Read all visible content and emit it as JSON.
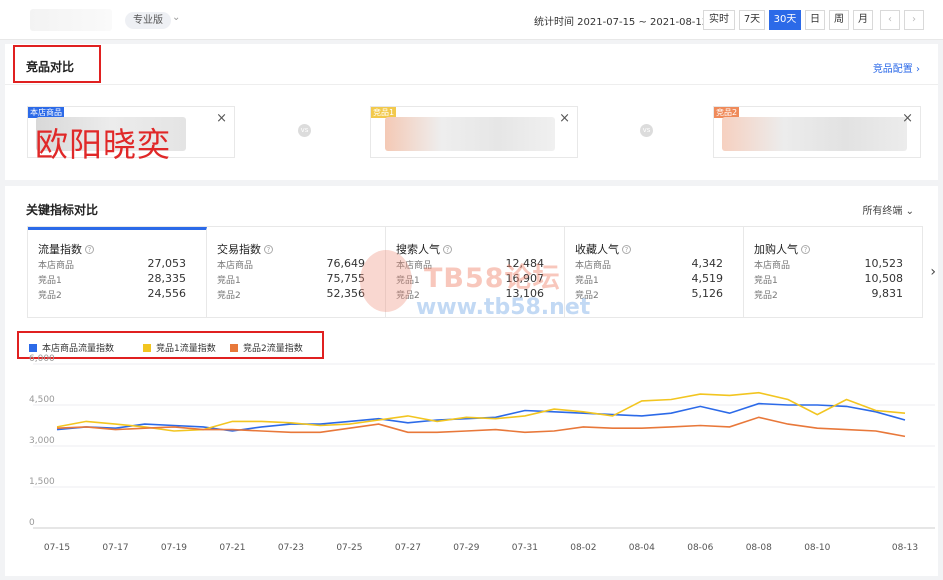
{
  "topbar": {
    "edition": "专业版",
    "period": "统计时间 2021-07-15 ~ 2021-08-13",
    "ranges": [
      "实时",
      "7天",
      "30天",
      "日",
      "周",
      "月"
    ],
    "active_range": "30天",
    "prev": "‹",
    "next": "›"
  },
  "compare": {
    "title": "竞品对比",
    "config_link": "竞品配置 ›",
    "overlay_text": "欧阳晓奕",
    "products": [
      {
        "tag": "本店商品",
        "tag_color": "#2c6ae8"
      },
      {
        "tag": "竞品1",
        "tag_color": "#f2c94c"
      },
      {
        "tag": "竞品2",
        "tag_color": "#ef8a5a"
      }
    ],
    "close": "×",
    "vs": "vs"
  },
  "indicators": {
    "title": "关键指标对比",
    "filter": "所有终端 ⌄",
    "metrics": [
      {
        "name": "流量指数",
        "rows": [
          {
            "label": "本店商品",
            "value": "27,053"
          },
          {
            "label": "竞品1",
            "value": "28,335"
          },
          {
            "label": "竞品2",
            "value": "24,556"
          }
        ]
      },
      {
        "name": "交易指数",
        "rows": [
          {
            "label": "本店商品",
            "value": "76,649"
          },
          {
            "label": "竞品1",
            "value": "75,755"
          },
          {
            "label": "竞品2",
            "value": "52,356"
          }
        ]
      },
      {
        "name": "搜索人气",
        "rows": [
          {
            "label": "本店商品",
            "value": "12,484"
          },
          {
            "label": "竞品1",
            "value": "16,907"
          },
          {
            "label": "竞品2",
            "value": "13,106"
          }
        ]
      },
      {
        "name": "收藏人气",
        "rows": [
          {
            "label": "本店商品",
            "value": "4,342"
          },
          {
            "label": "竞品1",
            "value": "4,519"
          },
          {
            "label": "竞品2",
            "value": "5,126"
          }
        ]
      },
      {
        "name": "加购人气",
        "rows": [
          {
            "label": "本店商品",
            "value": "10,523"
          },
          {
            "label": "竞品1",
            "value": "10,508"
          },
          {
            "label": "竞品2",
            "value": "9,831"
          }
        ]
      }
    ],
    "help": "?",
    "more": "›"
  },
  "watermark": {
    "line1": "TB58论坛",
    "line2": "www.tb58.net"
  },
  "chart_data": {
    "type": "line",
    "x": [
      "07-15",
      "07-16",
      "07-17",
      "07-18",
      "07-19",
      "07-20",
      "07-21",
      "07-22",
      "07-23",
      "07-24",
      "07-25",
      "07-26",
      "07-27",
      "07-28",
      "07-29",
      "07-30",
      "07-31",
      "08-01",
      "08-02",
      "08-03",
      "08-04",
      "08-05",
      "08-06",
      "08-07",
      "08-08",
      "08-09",
      "08-10",
      "08-11",
      "08-12",
      "08-13"
    ],
    "x_tick_labels": [
      "07-15",
      "07-17",
      "07-19",
      "07-21",
      "07-23",
      "07-25",
      "07-27",
      "07-29",
      "07-31",
      "08-02",
      "08-04",
      "08-06",
      "08-08",
      "08-10",
      "08-13"
    ],
    "y_ticks": [
      "6,000",
      "4,500",
      "3,000",
      "1,500",
      "0"
    ],
    "ylim": [
      0,
      6000
    ],
    "series": [
      {
        "name": "本店商品流量指数",
        "color": "#2c6ae8",
        "values": [
          3600,
          3700,
          3650,
          3800,
          3750,
          3700,
          3550,
          3700,
          3800,
          3800,
          3900,
          4000,
          3850,
          3950,
          4000,
          4050,
          4300,
          4250,
          4200,
          4150,
          4100,
          4200,
          4450,
          4200,
          4550,
          4500,
          4500,
          4450,
          4250,
          3950
        ]
      },
      {
        "name": "竞品1流量指数",
        "color": "#f2c520",
        "values": [
          3700,
          3900,
          3800,
          3700,
          3550,
          3600,
          3900,
          3900,
          3850,
          3750,
          3800,
          3950,
          4100,
          3900,
          4050,
          4000,
          4100,
          4350,
          4250,
          4100,
          4650,
          4700,
          4900,
          4850,
          4950,
          4700,
          4150,
          4700,
          4300,
          4200
        ]
      },
      {
        "name": "竞品2流量指数",
        "color": "#e8783a",
        "values": [
          3650,
          3700,
          3600,
          3650,
          3700,
          3600,
          3600,
          3550,
          3500,
          3500,
          3650,
          3800,
          3500,
          3500,
          3550,
          3600,
          3500,
          3550,
          3700,
          3650,
          3650,
          3700,
          3750,
          3700,
          4050,
          3800,
          3650,
          3600,
          3550,
          3350
        ]
      }
    ]
  }
}
